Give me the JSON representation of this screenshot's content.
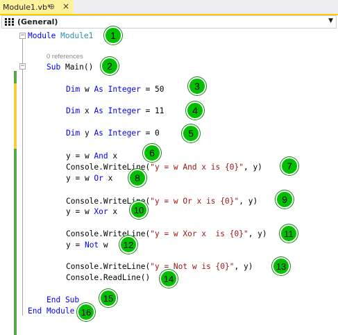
{
  "tab": {
    "title": "Module1.vb*",
    "pin": "⊕",
    "close": "×"
  },
  "combo": {
    "value": "(General)"
  },
  "references": "0 references",
  "code": {
    "l1_kw": "Module",
    "l1_id": "Module1",
    "l2_kw": "Sub",
    "l2_rest": " Main()",
    "l3_a": "Dim",
    "l3_b": " w ",
    "l3_c": "As",
    "l3_d": "Integer",
    "l3_e": " = 50",
    "l4_a": "Dim",
    "l4_b": " x ",
    "l4_c": "As",
    "l4_d": "Integer",
    "l4_e": " = 11",
    "l5_a": "Dim",
    "l5_b": " y ",
    "l5_c": "As",
    "l5_d": "Integer",
    "l5_e": " = 0",
    "l6_a": "y = w ",
    "l6_b": "And",
    "l6_c": " x",
    "l7_a": "Console.WriteLine(",
    "l7_b": "\"y = w And x is {0}\"",
    "l7_c": ", y)",
    "l8_a": "y = w ",
    "l8_b": "Or",
    "l8_c": " x",
    "l9_a": "Console.WriteLine(",
    "l9_b": "\"y = w Or x is {0}\"",
    "l9_c": ", y)",
    "l10_a": "y = w ",
    "l10_b": "Xor",
    "l10_c": " x",
    "l11_a": "Console.WriteLine(",
    "l11_b": "\"y = w Xor x  is {0}\"",
    "l11_c": ", y)",
    "l12_a": "y = ",
    "l12_b": "Not",
    "l12_c": " w",
    "l13_a": "Console.WriteLine(",
    "l13_b": "\"y = Not w is {0}\"",
    "l13_c": ", y)",
    "l14": "Console.ReadLine()",
    "l15": "End Sub",
    "l16": "End Module"
  },
  "badges": [
    "1",
    "2",
    "3",
    "4",
    "5",
    "6",
    "7",
    "8",
    "9",
    "10",
    "11",
    "12",
    "13",
    "14",
    "15",
    "16"
  ],
  "colors": {
    "keyword": "#0000ff",
    "string": "#a31515",
    "type_name": "#2b91af",
    "badge": "#00c000",
    "change_saved": "#57a64a",
    "change_unsaved": "#f5d23c",
    "active_tab": "#fff29d"
  }
}
